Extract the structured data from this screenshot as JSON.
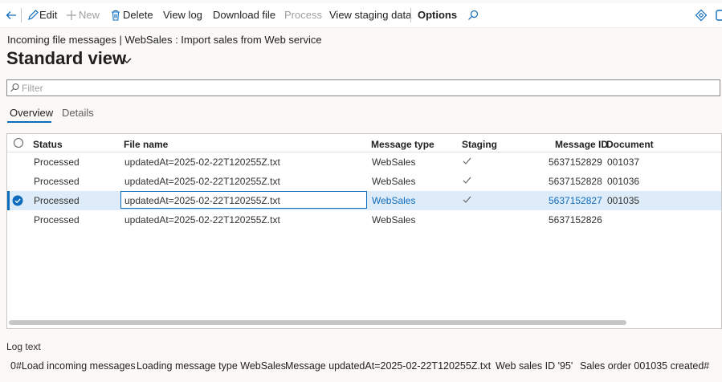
{
  "toolbar": {
    "edit": "Edit",
    "new": "New",
    "delete": "Delete",
    "view_log": "View log",
    "download_file": "Download file",
    "process": "Process",
    "view_staging_data": "View staging data",
    "options": "Options",
    "icons": [
      "back-arrow-icon",
      "edit-icon",
      "plus-icon",
      "trash-icon",
      "search-icon",
      "diamond-icon",
      "office-icon"
    ]
  },
  "breadcrumb": "Incoming file messages  |  WebSales : Import sales from Web service",
  "page_title": "Standard view",
  "filter": {
    "placeholder": "Filter"
  },
  "tabs": [
    {
      "label": "Overview",
      "active": true
    },
    {
      "label": "Details",
      "active": false
    }
  ],
  "grid": {
    "columns": [
      "Status",
      "File name",
      "Message type",
      "Staging",
      "Message ID",
      "Document"
    ],
    "rows": [
      {
        "status": "Processed",
        "file_name": "updatedAt=2025-02-22T120255Z.txt",
        "message_type": "WebSales",
        "staging": true,
        "message_id": "5637152829",
        "document": "001037",
        "selected": false
      },
      {
        "status": "Processed",
        "file_name": "updatedAt=2025-02-22T120255Z.txt",
        "message_type": "WebSales",
        "staging": true,
        "message_id": "5637152828",
        "document": "001036",
        "selected": false
      },
      {
        "status": "Processed",
        "file_name": "updatedAt=2025-02-22T120255Z.txt",
        "message_type": "WebSales",
        "staging": true,
        "message_id": "5637152827",
        "document": "001035",
        "selected": true
      },
      {
        "status": "Processed",
        "file_name": "updatedAt=2025-02-22T120255Z.txt",
        "message_type": "WebSales",
        "staging": false,
        "message_id": "5637152826",
        "document": "",
        "selected": false
      }
    ]
  },
  "log": {
    "label": "Log text",
    "items": [
      "0#Load incoming messages",
      "Loading message type WebSales",
      "Message updatedAt=2025-02-22T120255Z.txt",
      "Web sales ID '95'",
      "Sales order 001035 created#"
    ]
  },
  "colors": {
    "accent": "#0f6cbd",
    "selected_row": "#deecf9",
    "disabled": "#a19f9d"
  }
}
